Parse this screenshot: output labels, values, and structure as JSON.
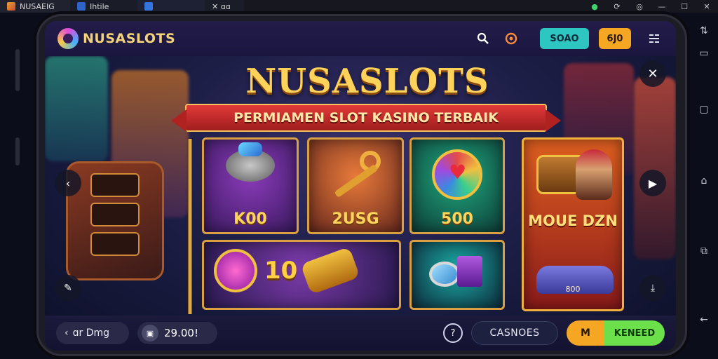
{
  "os_bar": {
    "tabs": [
      {
        "label": "NUSAEIG"
      },
      {
        "label": "Ihtile"
      },
      {
        "label": ""
      },
      {
        "label": "✕ ɑɑ"
      }
    ]
  },
  "header": {
    "logo_text": "NUSASLOTS",
    "search_icon": "search-icon",
    "sound_icon": "sound-icon",
    "primary_button": "SOAO",
    "secondary_button": "6J0",
    "menu_icon": "menu-icon"
  },
  "banner": {
    "title": "NUSASLOTS",
    "subtitle": "PERMIAMEN SLOT KASINO TERBAIK"
  },
  "tiles": [
    {
      "value": "K00"
    },
    {
      "value": "2USG"
    },
    {
      "value": "500"
    },
    {
      "value": "10"
    },
    {
      "value": ""
    }
  ],
  "featured": {
    "title": "MOUE DZN",
    "value": "800"
  },
  "bottom_bar": {
    "back_label": "ɑr Dmg",
    "balance": "29.00!",
    "casino_label": "CASNOES",
    "combo_left": "M",
    "combo_right": "KENEED"
  },
  "colors": {
    "accent_teal": "#2ec6c0",
    "accent_orange": "#f5a623",
    "accent_green": "#6be04a",
    "gold": "#ffd25a"
  }
}
